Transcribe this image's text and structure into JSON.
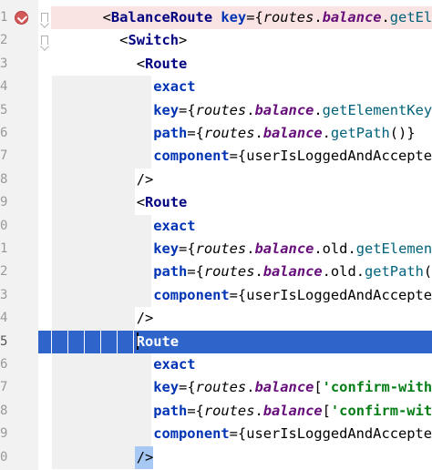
{
  "editor": {
    "lines": [
      {
        "ln": "1",
        "tokens": [
          {
            "t": "<",
            "c": "punct"
          },
          {
            "t": "BalanceRoute",
            "c": "tag"
          },
          {
            "t": " ",
            "c": "punct"
          },
          {
            "t": "key",
            "c": "attr"
          },
          {
            "t": "={",
            "c": "punct"
          },
          {
            "t": "routes",
            "c": "it"
          },
          {
            "t": ".",
            "c": "punct"
          },
          {
            "t": "balance",
            "c": "it-bold"
          },
          {
            "t": ".",
            "c": "punct"
          },
          {
            "t": "getEle",
            "c": "method"
          }
        ]
      },
      {
        "ln": "2",
        "tokens": [
          {
            "t": "<",
            "c": "punct"
          },
          {
            "t": "Switch",
            "c": "tag"
          },
          {
            "t": ">",
            "c": "punct"
          }
        ]
      },
      {
        "ln": "3",
        "tokens": [
          {
            "t": "<",
            "c": "punct"
          },
          {
            "t": "Route",
            "c": "tag"
          }
        ]
      },
      {
        "ln": "4",
        "tokens": [
          {
            "t": "exact",
            "c": "attr"
          }
        ]
      },
      {
        "ln": "5",
        "tokens": [
          {
            "t": "key",
            "c": "attr"
          },
          {
            "t": "={",
            "c": "punct"
          },
          {
            "t": "routes",
            "c": "it"
          },
          {
            "t": ".",
            "c": "punct"
          },
          {
            "t": "balance",
            "c": "it-bold"
          },
          {
            "t": ".",
            "c": "punct"
          },
          {
            "t": "getElementKey",
            "c": "method"
          },
          {
            "t": "(",
            "c": "punct"
          }
        ]
      },
      {
        "ln": "6",
        "tokens": [
          {
            "t": "path",
            "c": "attr"
          },
          {
            "t": "={",
            "c": "punct"
          },
          {
            "t": "routes",
            "c": "it"
          },
          {
            "t": ".",
            "c": "punct"
          },
          {
            "t": "balance",
            "c": "it-bold"
          },
          {
            "t": ".",
            "c": "punct"
          },
          {
            "t": "getPath",
            "c": "method"
          },
          {
            "t": "()}",
            "c": "punct"
          }
        ]
      },
      {
        "ln": "7",
        "tokens": [
          {
            "t": "component",
            "c": "attr"
          },
          {
            "t": "={",
            "c": "punct"
          },
          {
            "t": "userIsLoggedAndAccepted",
            "c": "ident"
          }
        ]
      },
      {
        "ln": "8",
        "tokens": [
          {
            "t": "/>",
            "c": "punct"
          }
        ]
      },
      {
        "ln": "9",
        "tokens": [
          {
            "t": "<",
            "c": "punct"
          },
          {
            "t": "Route",
            "c": "tag"
          }
        ]
      },
      {
        "ln": "0",
        "tokens": [
          {
            "t": "exact",
            "c": "attr"
          }
        ]
      },
      {
        "ln": "1",
        "tokens": [
          {
            "t": "key",
            "c": "attr"
          },
          {
            "t": "={",
            "c": "punct"
          },
          {
            "t": "routes",
            "c": "it"
          },
          {
            "t": ".",
            "c": "punct"
          },
          {
            "t": "balance",
            "c": "it-bold"
          },
          {
            "t": ".",
            "c": "punct"
          },
          {
            "t": "old",
            "c": "ident"
          },
          {
            "t": ".",
            "c": "punct"
          },
          {
            "t": "getElement",
            "c": "method"
          }
        ]
      },
      {
        "ln": "2",
        "tokens": [
          {
            "t": "path",
            "c": "attr"
          },
          {
            "t": "={",
            "c": "punct"
          },
          {
            "t": "routes",
            "c": "it"
          },
          {
            "t": ".",
            "c": "punct"
          },
          {
            "t": "balance",
            "c": "it-bold"
          },
          {
            "t": ".",
            "c": "punct"
          },
          {
            "t": "old",
            "c": "ident"
          },
          {
            "t": ".",
            "c": "punct"
          },
          {
            "t": "getPath",
            "c": "method"
          },
          {
            "t": "()",
            "c": "punct"
          }
        ]
      },
      {
        "ln": "3",
        "tokens": [
          {
            "t": "component",
            "c": "attr"
          },
          {
            "t": "={",
            "c": "punct"
          },
          {
            "t": "userIsLoggedAndAccepted",
            "c": "ident"
          }
        ]
      },
      {
        "ln": "4",
        "tokens": [
          {
            "t": "/>",
            "c": "punct"
          }
        ]
      },
      {
        "ln": "5",
        "tokens": [
          {
            "t": "Route",
            "c": "tag"
          }
        ]
      },
      {
        "ln": "6",
        "tokens": [
          {
            "t": "exact",
            "c": "attr"
          }
        ]
      },
      {
        "ln": "7",
        "tokens": [
          {
            "t": "key",
            "c": "attr"
          },
          {
            "t": "={",
            "c": "punct"
          },
          {
            "t": "routes",
            "c": "it"
          },
          {
            "t": ".",
            "c": "punct"
          },
          {
            "t": "balance",
            "c": "it-bold"
          },
          {
            "t": "[",
            "c": "punct"
          },
          {
            "t": "'confirm-withd",
            "c": "str"
          }
        ]
      },
      {
        "ln": "8",
        "tokens": [
          {
            "t": "path",
            "c": "attr"
          },
          {
            "t": "={",
            "c": "punct"
          },
          {
            "t": "routes",
            "c": "it"
          },
          {
            "t": ".",
            "c": "punct"
          },
          {
            "t": "balance",
            "c": "it-bold"
          },
          {
            "t": "[",
            "c": "punct"
          },
          {
            "t": "'confirm-with",
            "c": "str"
          }
        ]
      },
      {
        "ln": "9",
        "tokens": [
          {
            "t": "component",
            "c": "attr"
          },
          {
            "t": "={",
            "c": "punct"
          },
          {
            "t": "userIsLoggedAndAccepted",
            "c": "ident"
          }
        ]
      },
      {
        "ln": "0",
        "tokens": [
          {
            "t": "/>",
            "c": "punct"
          }
        ]
      }
    ]
  },
  "colors": {
    "current_line": "#2f65ca",
    "breakpoint_line": "#fae3e3",
    "indent_guide_bg": "#f0f0f0",
    "selection_bracket": "#a6c8f2"
  },
  "icons": {
    "breakpoint": "breakpoint-check-icon",
    "fold": "fold-marker-icon"
  }
}
